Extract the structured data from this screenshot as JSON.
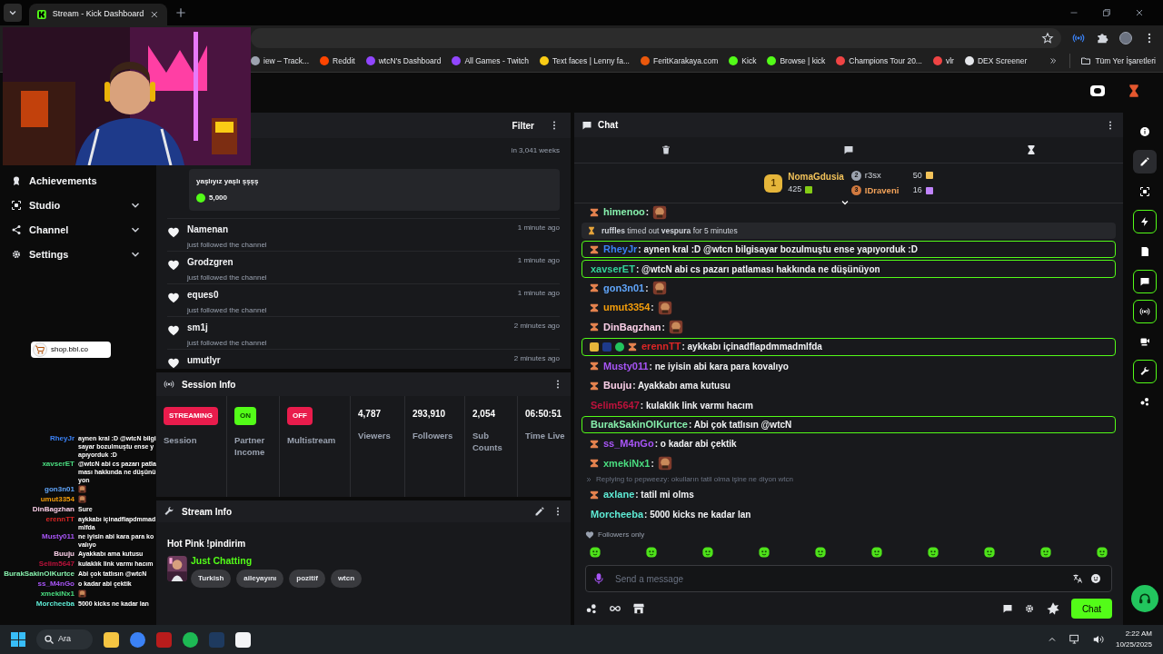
{
  "browser": {
    "tab_title": "Stream - Kick Dashboard",
    "bookmarks": [
      {
        "label": "iew – Track...",
        "color": "#9ca3af"
      },
      {
        "label": "Reddit",
        "color": "#ff4500"
      },
      {
        "label": "wtcN's Dashboard",
        "color": "#9146ff"
      },
      {
        "label": "All Games - Twitch",
        "color": "#9146ff"
      },
      {
        "label": "Text faces | Lenny fa...",
        "color": "#facc15"
      },
      {
        "label": "FeritKarakaya.com",
        "color": "#ea580c"
      },
      {
        "label": "Kick",
        "color": "#53fc18"
      },
      {
        "label": "Browse | kick",
        "color": "#53fc18"
      },
      {
        "label": "Champions Tour 20...",
        "color": "#ef4444"
      },
      {
        "label": "vlr",
        "color": "#ef4444"
      },
      {
        "label": "DEX Screener",
        "color": "#e5e7eb"
      }
    ],
    "all_bookmarks": "Tüm Yer İşaretleri"
  },
  "sidebar": {
    "items": [
      {
        "label": "Achievements",
        "kind": "link"
      },
      {
        "label": "Studio",
        "kind": "group"
      },
      {
        "label": "Channel",
        "kind": "group"
      },
      {
        "label": "Settings",
        "kind": "group"
      }
    ],
    "promo": "shop.bbl.co"
  },
  "activity": {
    "filter": "Filter",
    "items": [
      {
        "kind": "message",
        "time": "in 3,041 weeks",
        "message": "yaşlıyız yaşlı şşşş",
        "amount": "5,000"
      },
      {
        "kind": "follow",
        "user": "Namenan",
        "text": "just followed the channel",
        "time": "1 minute ago"
      },
      {
        "kind": "follow",
        "user": "Grodzgren",
        "text": "just followed the channel",
        "time": "1 minute ago"
      },
      {
        "kind": "follow",
        "user": "eques0",
        "text": "just followed the channel",
        "time": "1 minute ago"
      },
      {
        "kind": "follow",
        "user": "sm1j",
        "text": "just followed the channel",
        "time": "2 minutes ago"
      },
      {
        "kind": "follow",
        "user": "umutlyr",
        "time": "2 minutes ago"
      }
    ]
  },
  "session": {
    "title": "Session Info",
    "stats": [
      {
        "kind": "badge",
        "value": "STREAMING",
        "label": "Session",
        "color": "#e91c4c"
      },
      {
        "kind": "badge",
        "value": "ON",
        "label": "Partner Income",
        "color": "#53fc18"
      },
      {
        "kind": "badge",
        "value": "OFF",
        "label": "Multistream",
        "color": "#e91c4c"
      },
      {
        "kind": "number",
        "value": "4,787",
        "label": "Viewers"
      },
      {
        "kind": "number",
        "value": "293,910",
        "label": "Followers"
      },
      {
        "kind": "number",
        "value": "2,054",
        "label": "Sub Counts"
      },
      {
        "kind": "number",
        "value": "06:50:51",
        "label": "Time Live"
      }
    ]
  },
  "stream_info": {
    "title": "Stream Info",
    "stream_title": "Hot Pink !pindirim",
    "category": "Just Chatting",
    "tags": [
      "Turkish",
      "aileyayını",
      "pozitif",
      "wtcn"
    ]
  },
  "chat": {
    "title": "Chat",
    "leaderboard": [
      {
        "rank": "1",
        "name": "NomaGdusia",
        "count": "425"
      },
      {
        "rank": "2",
        "name": "r3sx",
        "count": "50"
      },
      {
        "rank": "3",
        "name": "IDraveni",
        "count": "16"
      }
    ],
    "messages": [
      {
        "kind": "chat",
        "user": "himenoo",
        "color": "#86efac",
        "badge": true,
        "text": ":",
        "emote": true,
        "highlighted": false
      },
      {
        "kind": "system",
        "text": "**ruffles** timed out **vespura** for 5 minutes"
      },
      {
        "kind": "chat",
        "user": "RheyJr",
        "color": "#3b82f6",
        "badge": true,
        "text": ": aynen kral :D @wtcn bilgisayar bozulmuştu ense yapıyorduk :D",
        "highlighted": true
      },
      {
        "kind": "chat",
        "user": "xavserET",
        "color": "#34d399",
        "badge": false,
        "text": ": @wtcN abi cs pazarı patlaması hakkında ne düşünüyon",
        "highlighted": true
      },
      {
        "kind": "chat",
        "user": "gon3n01",
        "color": "#60a5fa",
        "badge": true,
        "text": ":",
        "emote": true,
        "highlighted": false
      },
      {
        "kind": "chat",
        "user": "umut3354",
        "color": "#f59e0b",
        "badge": true,
        "text": ":",
        "emote": true,
        "highlighted": false
      },
      {
        "kind": "chat",
        "user": "DinBagzhan",
        "color": "#fbcfe8",
        "badge": true,
        "text": ":",
        "emote": true,
        "highlighted": false
      },
      {
        "kind": "chat",
        "user": "erennTT",
        "color": "#dc2626",
        "badge": true,
        "vip": true,
        "text": ": aykkabı içinadflapdmmadmlfda",
        "highlighted": true
      },
      {
        "kind": "chat",
        "user": "Musty011",
        "color": "#a855f7",
        "badge": true,
        "text": ": ne iyisin abi kara para kovalıyo",
        "highlighted": false
      },
      {
        "kind": "chat",
        "user": "Buuju",
        "color": "#fbcfe8",
        "badge": true,
        "text": ": Ayakkabı ama kutusu",
        "highlighted": false
      },
      {
        "kind": "chat",
        "user": "Selim5647",
        "color": "#be123c",
        "badge": false,
        "text": ": kulaklık link varmı hacım",
        "highlighted": false
      },
      {
        "kind": "chat",
        "user": "BurakSakinOlKurtce",
        "color": "#86efac",
        "badge": false,
        "text": ": Abi çok tatlısın @wtcN",
        "highlighted": true
      },
      {
        "kind": "chat",
        "user": "ss_M4nGo",
        "color": "#a855f7",
        "badge": true,
        "text": ": o kadar abi çektik",
        "highlighted": false
      },
      {
        "kind": "chat",
        "user": "xmekiNx1",
        "color": "#4ade80",
        "badge": true,
        "text": ":",
        "emote": true,
        "highlighted": false
      },
      {
        "kind": "reply",
        "text": "Replying to pepweezy: okulların tatil olma işine ne diyon wtcn"
      },
      {
        "kind": "chat",
        "user": "axlane",
        "color": "#5eead4",
        "badge": true,
        "text": ": tatil mi olms",
        "highlighted": false
      },
      {
        "kind": "chat",
        "user": "Morcheeba",
        "color": "#5eead4",
        "badge": false,
        "text": ": 5000 kicks ne kadar lan",
        "highlighted": false
      }
    ],
    "followers_only": "Followers only",
    "placeholder": "Send a message",
    "send": "Chat"
  },
  "overlay_chat": [
    {
      "user": "RheyJr",
      "color": "#3b82f6",
      "text": "aynen kral :D @wtcN bilgisayar bozulmuştu ense yapıyorduk :D"
    },
    {
      "user": "xavserET",
      "color": "#4ade80",
      "text": "@wtcN abi cs pazarı patlaması hakkında ne düşünüyon"
    },
    {
      "user": "gon3n01",
      "color": "#60a5fa",
      "emote": true
    },
    {
      "user": "umut3354",
      "color": "#f59e0b",
      "emote": true
    },
    {
      "user": "DinBagzhan",
      "color": "#fbcfe8",
      "text": "Sure"
    },
    {
      "user": "erennTT",
      "color": "#dc2626",
      "text": "aykkabı içinadflapdmmadmlfda"
    },
    {
      "user": "Musty011",
      "color": "#a855f7",
      "text": "ne iyisin abi kara para kovalıyo"
    },
    {
      "user": "Buuju",
      "color": "#fbcfe8",
      "text": "Ayakkabı ama kutusu"
    },
    {
      "user": "Selim5647",
      "color": "#be123c",
      "text": "kulaklık link varmı hacım"
    },
    {
      "user": "BurakSakinOlKurtce",
      "color": "#86efac",
      "text": "Abi çok tatlısın @wtcN"
    },
    {
      "user": "ss_M4nGo",
      "color": "#a855f7",
      "text": "o kadar abi çektik"
    },
    {
      "user": "xmekiNx1",
      "color": "#4ade80",
      "emote": true
    },
    {
      "user": "Morcheeba",
      "color": "#5eead4",
      "text": "5000 kicks ne kadar lan"
    }
  ],
  "taskbar": {
    "search": "Ara",
    "time": "2:22 AM",
    "date": "10/25/2025"
  }
}
